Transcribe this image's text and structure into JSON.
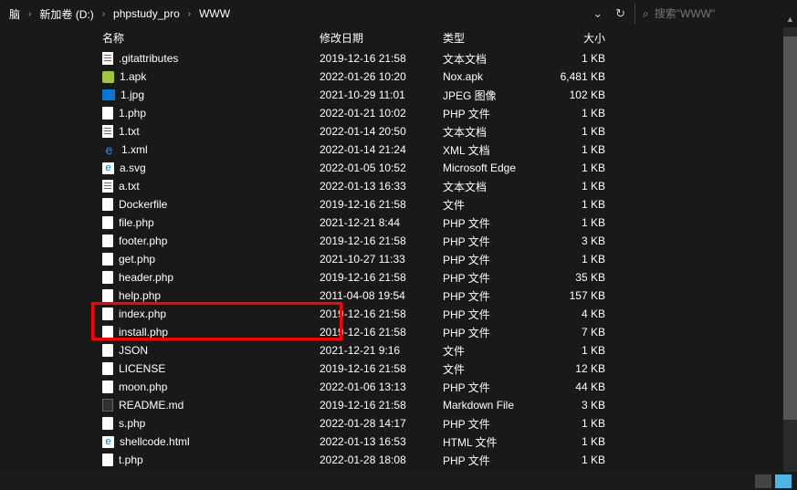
{
  "toolbar": {
    "breadcrumb": [
      "脑",
      "新加卷 (D:)",
      "phpstudy_pro",
      "WWW"
    ],
    "search_placeholder": "搜索\"WWW\""
  },
  "columns": {
    "name": "名称",
    "date": "修改日期",
    "type": "类型",
    "size": "大小"
  },
  "files": [
    {
      "icon": "txt",
      "name": ".gitattributes",
      "date": "2019-12-16 21:58",
      "type": "文本文档",
      "size": "1 KB"
    },
    {
      "icon": "apk",
      "name": "1.apk",
      "date": "2022-01-26 10:20",
      "type": "Nox.apk",
      "size": "6,481 KB"
    },
    {
      "icon": "img",
      "name": "1.jpg",
      "date": "2021-10-29 11:01",
      "type": "JPEG 图像",
      "size": "102 KB"
    },
    {
      "icon": "file",
      "name": "1.php",
      "date": "2022-01-21 10:02",
      "type": "PHP 文件",
      "size": "1 KB"
    },
    {
      "icon": "txt",
      "name": "1.txt",
      "date": "2022-01-14 20:50",
      "type": "文本文档",
      "size": "1 KB"
    },
    {
      "icon": "ie",
      "name": "1.xml",
      "date": "2022-01-14 21:24",
      "type": "XML 文档",
      "size": "1 KB"
    },
    {
      "icon": "edge",
      "name": "a.svg",
      "date": "2022-01-05 10:52",
      "type": "Microsoft Edge",
      "size": "1 KB"
    },
    {
      "icon": "txt",
      "name": "a.txt",
      "date": "2022-01-13 16:33",
      "type": "文本文档",
      "size": "1 KB"
    },
    {
      "icon": "file",
      "name": "Dockerfile",
      "date": "2019-12-16 21:58",
      "type": "文件",
      "size": "1 KB"
    },
    {
      "icon": "file",
      "name": "file.php",
      "date": "2021-12-21 8:44",
      "type": "PHP 文件",
      "size": "1 KB"
    },
    {
      "icon": "file",
      "name": "footer.php",
      "date": "2019-12-16 21:58",
      "type": "PHP 文件",
      "size": "3 KB"
    },
    {
      "icon": "file",
      "name": "get.php",
      "date": "2021-10-27 11:33",
      "type": "PHP 文件",
      "size": "1 KB"
    },
    {
      "icon": "file",
      "name": "header.php",
      "date": "2019-12-16 21:58",
      "type": "PHP 文件",
      "size": "35 KB"
    },
    {
      "icon": "file",
      "name": "help.php",
      "date": "2011-04-08 19:54",
      "type": "PHP 文件",
      "size": "157 KB"
    },
    {
      "icon": "file",
      "name": "index.php",
      "date": "2019-12-16 21:58",
      "type": "PHP 文件",
      "size": "4 KB",
      "hl": true
    },
    {
      "icon": "file",
      "name": "install.php",
      "date": "2019-12-16 21:58",
      "type": "PHP 文件",
      "size": "7 KB",
      "hl": true
    },
    {
      "icon": "file",
      "name": "JSON",
      "date": "2021-12-21 9:16",
      "type": "文件",
      "size": "1 KB"
    },
    {
      "icon": "file",
      "name": "LICENSE",
      "date": "2019-12-16 21:58",
      "type": "文件",
      "size": "12 KB"
    },
    {
      "icon": "file",
      "name": "moon.php",
      "date": "2022-01-06 13:13",
      "type": "PHP 文件",
      "size": "44 KB"
    },
    {
      "icon": "md",
      "name": "README.md",
      "date": "2019-12-16 21:58",
      "type": "Markdown File",
      "size": "3 KB"
    },
    {
      "icon": "file",
      "name": "s.php",
      "date": "2022-01-28 14:17",
      "type": "PHP 文件",
      "size": "1 KB"
    },
    {
      "icon": "edge",
      "name": "shellcode.html",
      "date": "2022-01-13 16:53",
      "type": "HTML 文件",
      "size": "1 KB"
    },
    {
      "icon": "file",
      "name": "t.php",
      "date": "2022-01-28 18:08",
      "type": "PHP 文件",
      "size": "1 KB"
    }
  ]
}
